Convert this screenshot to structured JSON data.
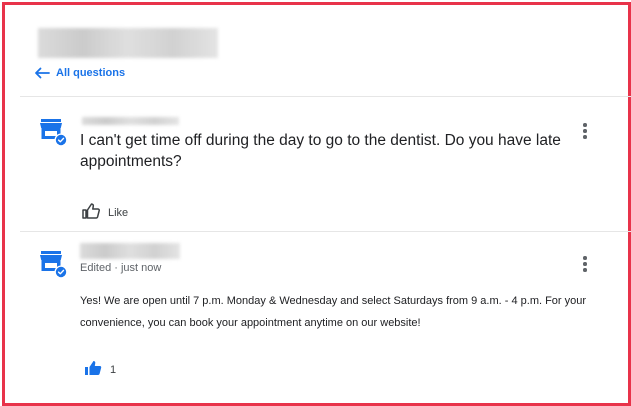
{
  "header": {
    "back_label": "All questions"
  },
  "question": {
    "text": "I can't get time off during the day to go to the dentist. Do you have late appointments?",
    "like_label": "Like",
    "avatar_icon": "storefront-verified-icon",
    "menu_icon": "more-vert-icon"
  },
  "answer": {
    "meta": "Edited · just now",
    "text": "Yes! We are open until 7 p.m. Monday & Wednesday and select Saturdays from 9 a.m. - 4 p.m. For your convenience, you can book your appointment anytime on our website!",
    "like_count": "1",
    "avatar_icon": "storefront-verified-icon",
    "menu_icon": "more-vert-icon"
  },
  "colors": {
    "frame_border": "#e8334a",
    "accent_blue": "#1a73e8",
    "text": "#202124",
    "muted": "#5f6368"
  }
}
